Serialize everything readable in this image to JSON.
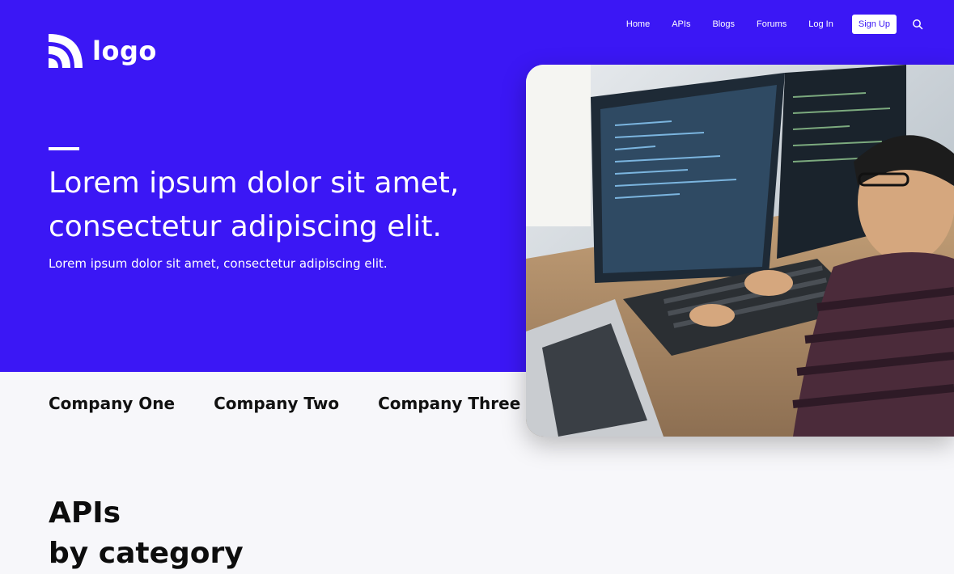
{
  "brand": {
    "logo_text": "logo"
  },
  "nav": {
    "items": [
      "Home",
      "APIs",
      "Blogs",
      "Forums",
      "Log In"
    ],
    "signup_label": "Sign Up",
    "search_icon": "search-icon"
  },
  "hero": {
    "headline": "Lorem ipsum dolor sit amet, consectetur adipiscing elit.",
    "subhead": "Lorem ipsum dolor sit amet, consectetur adipiscing elit."
  },
  "companies": [
    "Company One",
    "Company Two",
    "Company Three"
  ],
  "section": {
    "title_line1": "APIs",
    "title_line2": "by category"
  },
  "colors": {
    "brand_primary": "#3b17f5",
    "page_bg": "#f7f7fa"
  }
}
